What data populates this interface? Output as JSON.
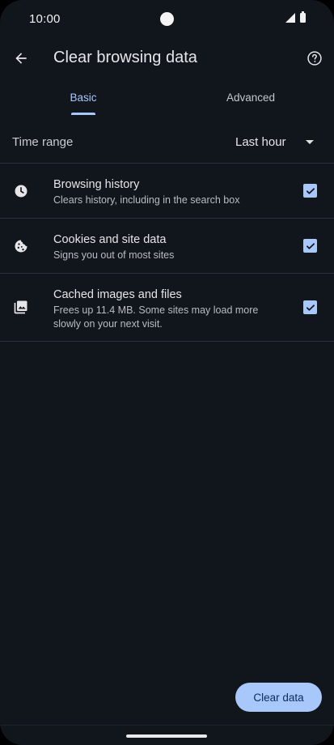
{
  "status_bar": {
    "time": "10:00",
    "icons": [
      "signal-icon",
      "battery-icon"
    ]
  },
  "app_bar": {
    "title": "Clear browsing data",
    "back_icon": "arrow-back-icon",
    "help_icon": "help-circle-icon"
  },
  "tabs": [
    {
      "label": "Basic",
      "selected": true
    },
    {
      "label": "Advanced",
      "selected": false
    }
  ],
  "time_range": {
    "label": "Time range",
    "value": "Last hour"
  },
  "options": [
    {
      "icon": "clock-icon",
      "title": "Browsing history",
      "subtitle": "Clears history, including in the search box",
      "checked": true
    },
    {
      "icon": "cookie-icon",
      "title": "Cookies and site data",
      "subtitle": "Signs you out of most sites",
      "checked": true
    },
    {
      "icon": "image-icon",
      "title": "Cached images and files",
      "subtitle": "Frees up 11.4 MB. Some sites may load more slowly on your next visit.",
      "checked": true
    }
  ],
  "clear_button": {
    "label": "Clear data"
  },
  "colors": {
    "background": "#11151c",
    "accent": "#a8c7fa",
    "divider": "#2c3038",
    "text": "#e6e6e9"
  }
}
